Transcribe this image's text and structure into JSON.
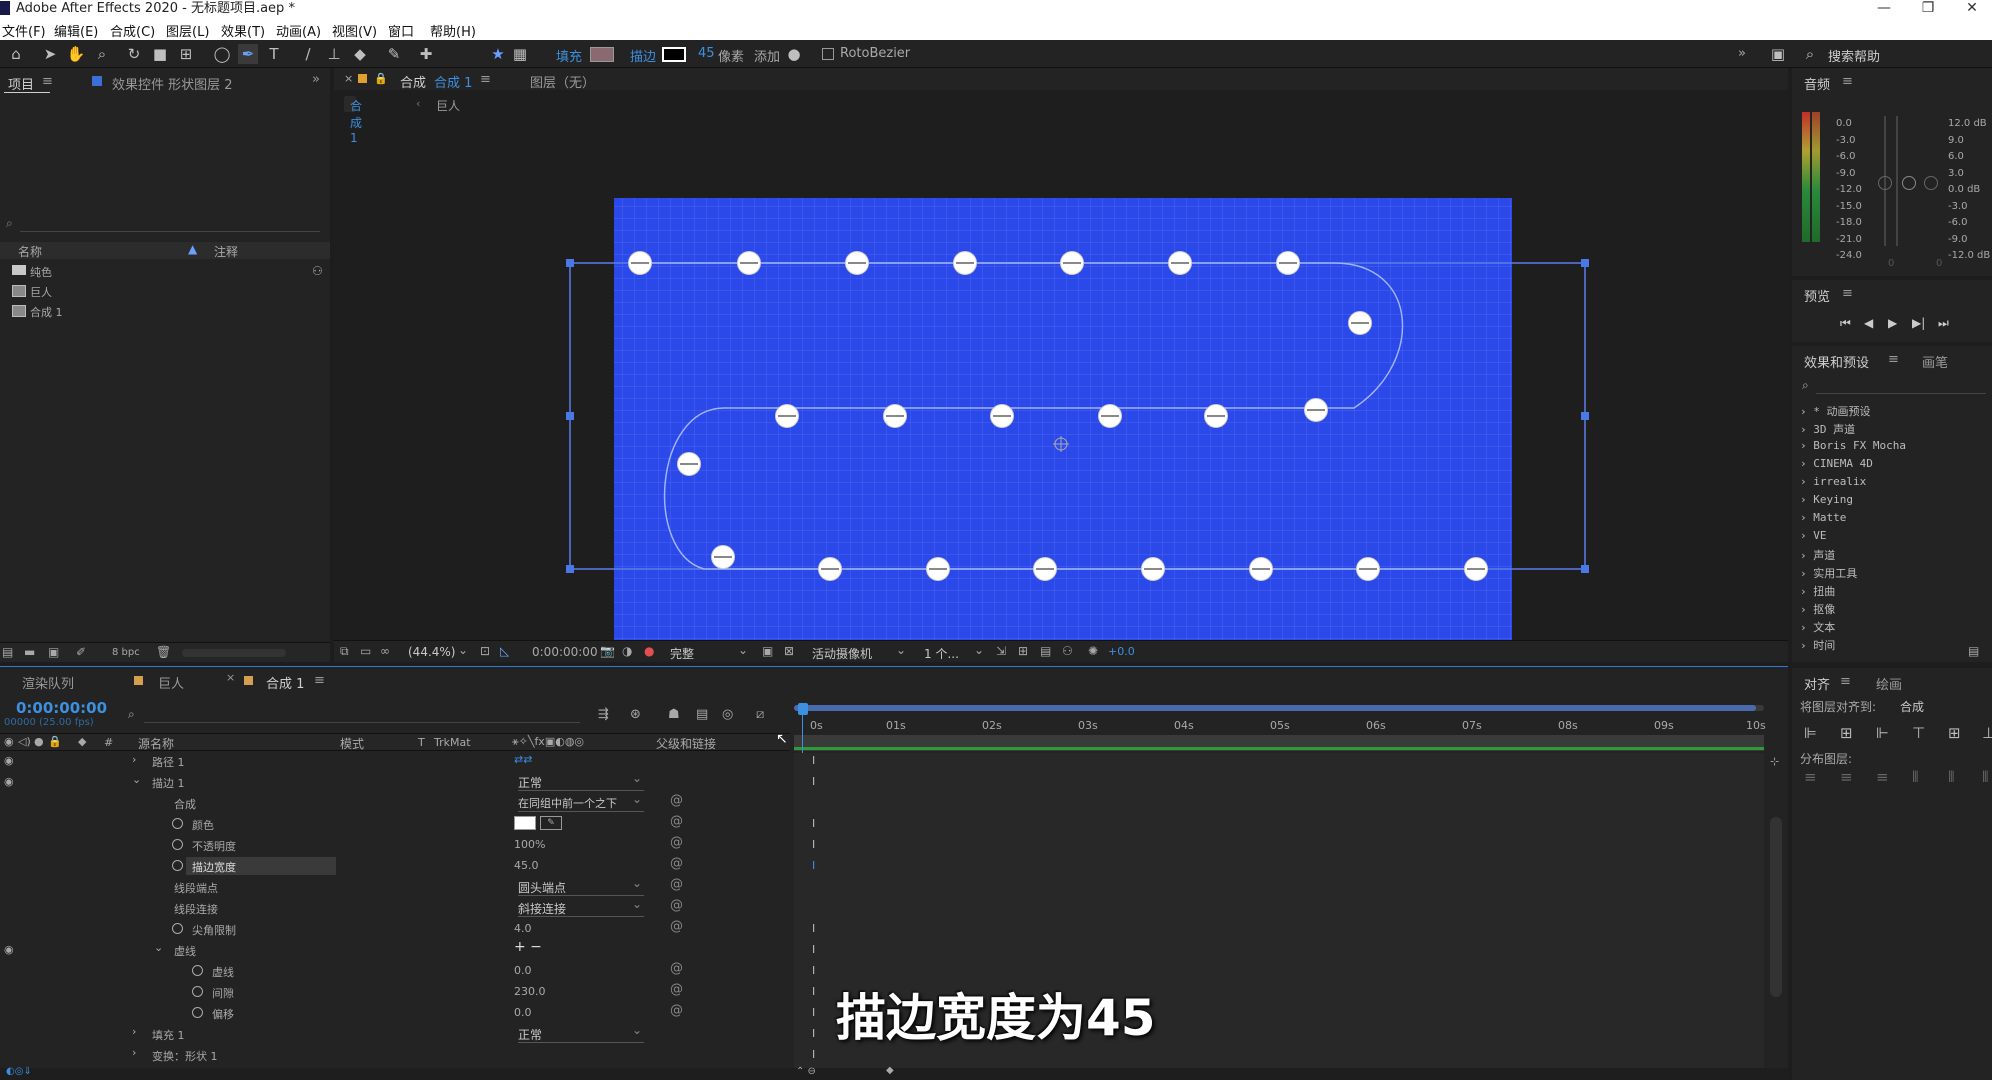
{
  "window": {
    "title": "Adobe After Effects 2020 - 无标题项目.aep *",
    "buttons": [
      "—",
      "❐",
      "✕"
    ]
  },
  "menu": [
    "文件(F)",
    "编辑(E)",
    "合成(C)",
    "图层(L)",
    "效果(T)",
    "动画(A)",
    "视图(V)",
    "窗口",
    "帮助(H)"
  ],
  "toolbar": {
    "fill_label": "填充",
    "stroke_label": "描边",
    "stroke_width": "45",
    "unit": "像素",
    "add_label": "添加",
    "rotobezier": "RotoBezier",
    "search_placeholder": "搜索帮助",
    "expand": "»"
  },
  "project_panel": {
    "tab_project": "项目",
    "tab_effects": "效果控件 形状图层 2",
    "col_name": "名称",
    "col_comment": "注释",
    "items": [
      "纯色",
      "巨人",
      "合成 1"
    ],
    "bpc": "8 bpc"
  },
  "comp_panel": {
    "tab_comp": "合成",
    "tab_comp_name": "合成 1",
    "tab_layer": "图层（无）",
    "crumb1": "合成 1",
    "crumb2": "巨人",
    "zoom": "(44.4%)",
    "timecode": "0:00:00:00",
    "quality": "完整",
    "camera": "活动摄像机",
    "views": "1 个...",
    "exposure": "+0.0"
  },
  "audio": {
    "title": "音频",
    "left_scale": [
      "0.0",
      "-3.0",
      "-6.0",
      "-9.0",
      "-12.0",
      "-15.0",
      "-18.0",
      "-21.0",
      "-24.0"
    ],
    "right_scale": [
      "12.0 dB",
      "9.0",
      "6.0",
      "3.0",
      "0.0 dB",
      "-3.0",
      "-6.0",
      "-9.0",
      "-12.0 dB"
    ],
    "fader_bottom": [
      "0",
      "0"
    ]
  },
  "preview": {
    "title": "预览"
  },
  "effects_presets": {
    "tab1": "效果和预设",
    "tab2": "画笔",
    "items": [
      "* 动画预设",
      "3D 声道",
      "Boris FX Mocha",
      "CINEMA 4D",
      "irrealix",
      "Keying",
      "Matte",
      "VE",
      "声道",
      "实用工具",
      "扭曲",
      "抠像",
      "文本",
      "时间"
    ]
  },
  "align": {
    "tab1": "对齐",
    "tab2": "绘画",
    "align_to_label": "将图层对齐到:",
    "align_to_value": "合成",
    "distribute_label": "分布图层:"
  },
  "timeline": {
    "tab_render": "渲染队列",
    "tab_giant": "巨人",
    "tab_comp": "合成 1",
    "timecode": "0:00:00:00",
    "fps": "00000 (25.00 fps)",
    "col_source": "源名称",
    "col_mode": "模式",
    "col_t": "T",
    "col_trkmat": "TrkMat",
    "col_parent": "父级和链接",
    "ruler": [
      "0s",
      "01s",
      "02s",
      "03s",
      "04s",
      "05s",
      "06s",
      "07s",
      "08s",
      "09s",
      "10s"
    ],
    "rows": [
      {
        "name": "路径 1",
        "value": ""
      },
      {
        "name": "描边 1",
        "value": "正常"
      },
      {
        "name": "合成",
        "value": "在同组中前一个之下"
      },
      {
        "name": "颜色",
        "value": ""
      },
      {
        "name": "不透明度",
        "value": "100%"
      },
      {
        "name": "描边宽度",
        "value": "45.0"
      },
      {
        "name": "线段端点",
        "value": "圆头端点"
      },
      {
        "name": "线段连接",
        "value": "斜接连接"
      },
      {
        "name": "尖角限制",
        "value": "4.0"
      },
      {
        "name": "虚线",
        "value": "+ −"
      },
      {
        "name": "虚线",
        "value": "0.0"
      },
      {
        "name": "间隙",
        "value": "230.0"
      },
      {
        "name": "偏移",
        "value": "0.0"
      },
      {
        "name": "填充 1",
        "value": "正常"
      },
      {
        "name": "变换：形状 1",
        "value": ""
      }
    ]
  },
  "subtitle": "描边宽度为45",
  "colors": {
    "canvas_blue": "#2b48e8",
    "accent_blue": "#3d8fe0",
    "selection_line": "#5a7fe8"
  }
}
